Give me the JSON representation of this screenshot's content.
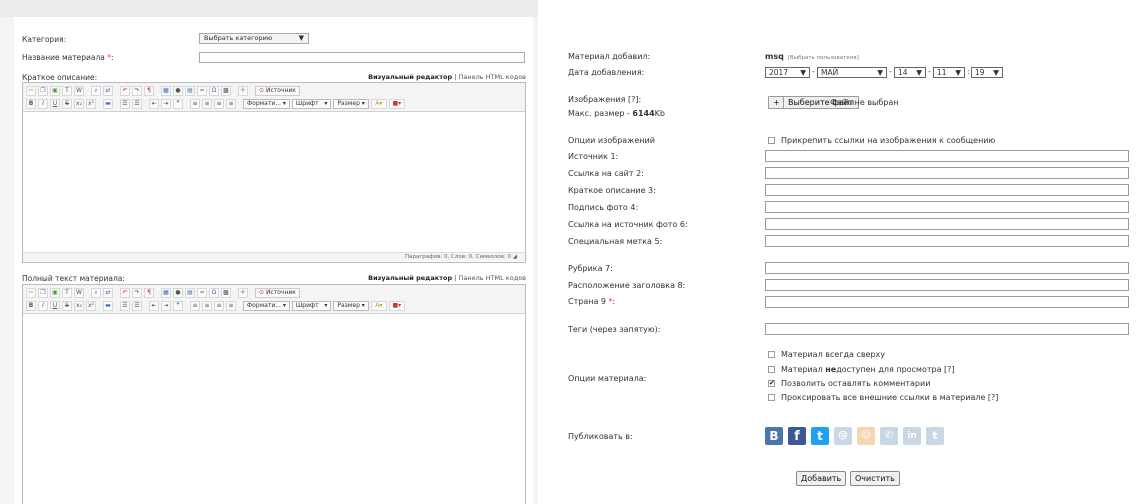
{
  "left": {
    "category_label": "Категория:",
    "category_value": "Выбрать категорию",
    "title_label": "Название материала",
    "title_required": "*",
    "title_colon": ":",
    "short_label": "Краткое описание:",
    "full_label": "Полный текст материала:",
    "visual_editor": "Визуальный редактор",
    "divider": "|",
    "html_panel": "Панель HTML кодов",
    "source_btn": "Источник",
    "format_dd": "Формати...",
    "font_dd": "Шрифт",
    "size_dd": "Размер",
    "short_status": "Параграфов: 0, Слов: 0, Символов: 0"
  },
  "right": {
    "added_by_label": "Материал добавил:",
    "added_by_user": "msq",
    "choose_user": "[Выбрать пользователя]",
    "date_label": "Дата добавления:",
    "date": {
      "year": "2017",
      "month": "МАЙ",
      "day": "14",
      "hour": "11",
      "minute": "19"
    },
    "images_label": "Изображения [?]:",
    "max_size_label": "Макс. размер -",
    "max_size_value": "6144",
    "max_size_unit": "Kb",
    "plus_btn": "+",
    "choose_file_btn": "Выберите файл",
    "no_file": "Файл не выбран",
    "image_options_label": "Опции изображений",
    "attach_links": "Прикрепить ссылки на изображения к сообщению",
    "fields": [
      "Источник 1:",
      "Ссылка на сайт 2:",
      "Краткое описание 3:",
      "Подпись фото 4:",
      "Ссылка на источник фото 6:",
      "Специальная метка 5:"
    ],
    "rubric_label": "Рубрика 7:",
    "headline_pos_label": "Расположение заголовка 8:",
    "country_label": "Страна 9",
    "country_req": "*",
    "country_colon": ":",
    "tags_label": "Теги (через запятую):",
    "material_options_label": "Опции материала:",
    "opt_top": "Материал всегда сверху",
    "opt_unavail_pre": "Материал ",
    "opt_unavail_bold": "не",
    "opt_unavail_post": "доступен для просмотра [?]",
    "opt_comments": "Позволить оставлять комментарии",
    "opt_proxy": "Проксировать все внешние ссылки в материале [?]",
    "publish_label": "Публиковать в:",
    "add_btn": "Добавить",
    "clear_btn": "Очистить"
  },
  "colors": {
    "vk": "#4a76a8",
    "facebook": "#3b5998",
    "twitter": "#1da1f2",
    "faded": "#c9d6e6"
  },
  "social_icons": {
    "vk": "В",
    "facebook": "f",
    "twitter": "t",
    "linkedin": "in",
    "tumblr": "t"
  }
}
